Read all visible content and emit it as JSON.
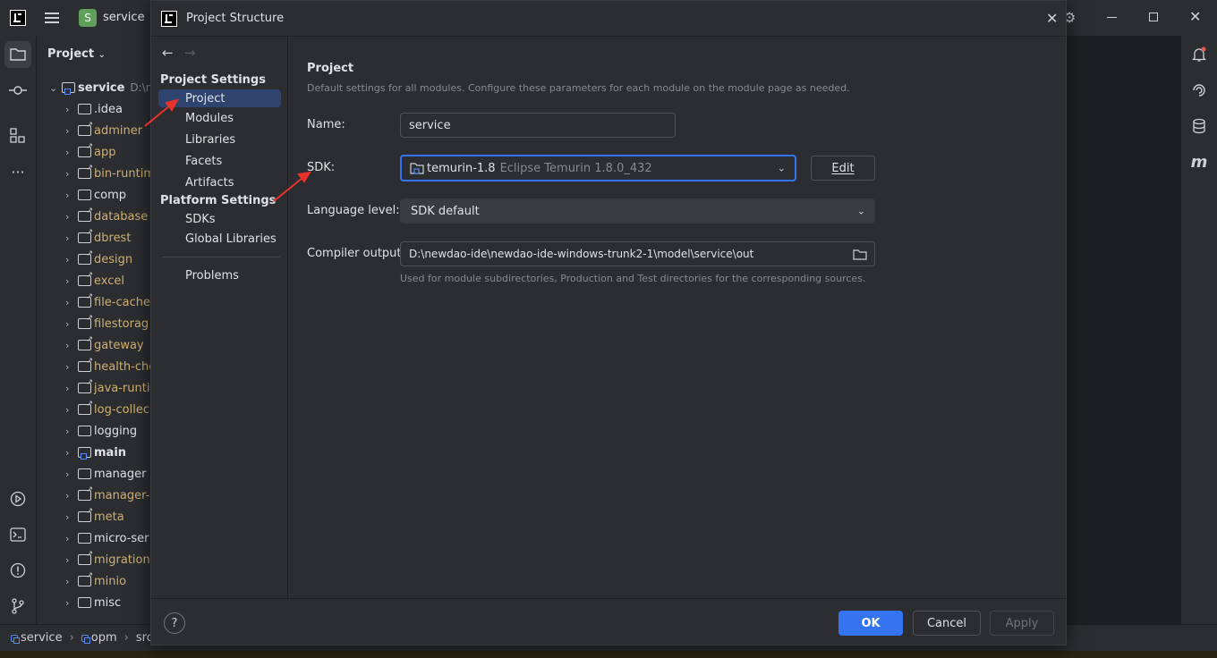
{
  "ide": {
    "project_badge": "S",
    "project_name": "service",
    "panel_title": "Project"
  },
  "tree": {
    "root_label": "service",
    "root_path": "D:\\ne",
    "items": [
      {
        "label": ".idea",
        "kind": "plain"
      },
      {
        "label": "adminer",
        "kind": "ext"
      },
      {
        "label": "app",
        "kind": "ext"
      },
      {
        "label": "bin-runtim",
        "kind": "ext"
      },
      {
        "label": "comp",
        "kind": "plain"
      },
      {
        "label": "database",
        "kind": "ext"
      },
      {
        "label": "dbrest",
        "kind": "ext"
      },
      {
        "label": "design",
        "kind": "ext"
      },
      {
        "label": "excel",
        "kind": "ext"
      },
      {
        "label": "file-cache",
        "kind": "ext"
      },
      {
        "label": "filestorag",
        "kind": "ext"
      },
      {
        "label": "gateway",
        "kind": "ext"
      },
      {
        "label": "health-che",
        "kind": "ext"
      },
      {
        "label": "java-runti",
        "kind": "ext"
      },
      {
        "label": "log-collec",
        "kind": "ext"
      },
      {
        "label": "logging",
        "kind": "plain"
      },
      {
        "label": "main",
        "kind": "mod"
      },
      {
        "label": "manager",
        "kind": "plain"
      },
      {
        "label": "manager-",
        "kind": "ext"
      },
      {
        "label": "meta",
        "kind": "ext"
      },
      {
        "label": "micro-ser",
        "kind": "plain"
      },
      {
        "label": "migration",
        "kind": "ext"
      },
      {
        "label": "minio",
        "kind": "ext"
      },
      {
        "label": "misc",
        "kind": "plain"
      }
    ]
  },
  "status_bar": {
    "crumbs": [
      "service",
      "opm",
      "src"
    ]
  },
  "dialog": {
    "title": "Project Structure",
    "nav": {
      "project_settings_header": "Project Settings",
      "project_settings_items": [
        "Project",
        "Modules",
        "Libraries",
        "Facets",
        "Artifacts"
      ],
      "platform_settings_header": "Platform Settings",
      "platform_settings_items": [
        "SDKs",
        "Global Libraries"
      ],
      "problems": "Problems"
    },
    "content": {
      "heading": "Project",
      "description": "Default settings for all modules. Configure these parameters for each module on the module page as needed.",
      "name_label": "Name:",
      "name_value": "service",
      "sdk_label": "SDK:",
      "sdk_name": "temurin-1.8",
      "sdk_detail": "Eclipse Temurin 1.8.0_432",
      "edit_button": "Edit",
      "language_level_label": "Language level:",
      "language_level_value": "SDK default",
      "compiler_output_label": "Compiler output:",
      "compiler_output_value": "D:\\newdao-ide\\newdao-ide-windows-trunk2-1\\model\\service\\out",
      "compiler_output_hint": "Used for module subdirectories, Production and Test directories for the corresponding sources."
    },
    "footer": {
      "help": "?",
      "ok": "OK",
      "cancel": "Cancel",
      "apply": "Apply"
    }
  },
  "colors": {
    "accent": "#3574f0",
    "annotation_arrow": "#e8322b"
  }
}
